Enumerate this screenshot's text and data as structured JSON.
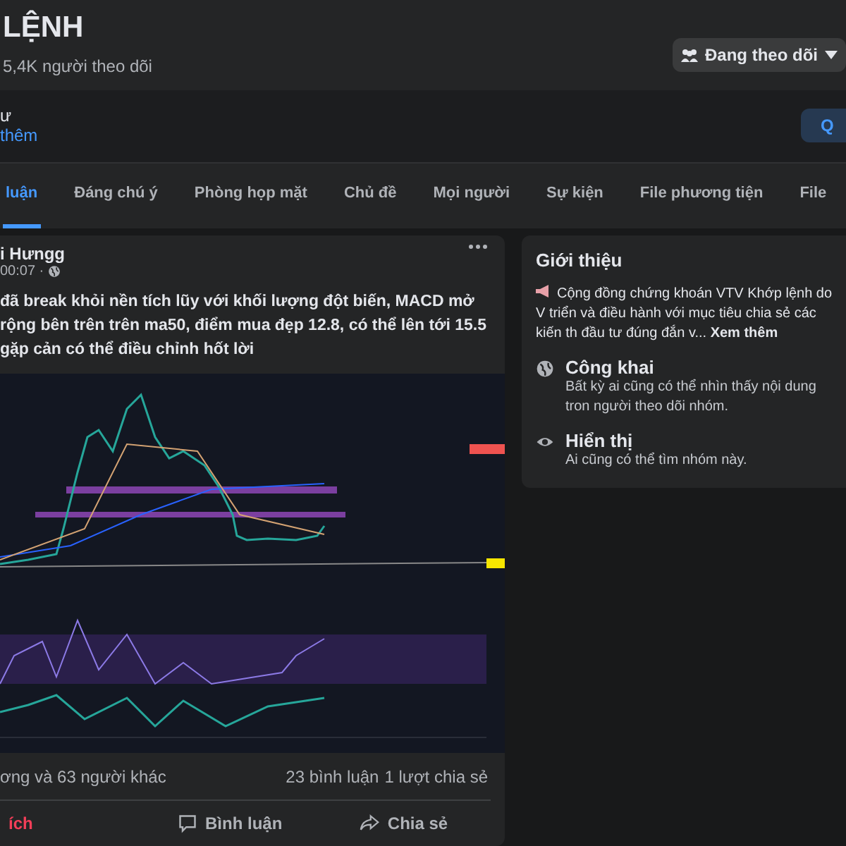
{
  "group": {
    "title": "LỆNH",
    "followers": "5,4K người theo dõi",
    "follow_button": "Đang theo dõi"
  },
  "banner": {
    "text_1": "ư",
    "link": "thêm",
    "button": "Q"
  },
  "tabs": [
    {
      "label": "luận",
      "selected": true
    },
    {
      "label": "Đáng chú ý",
      "selected": false
    },
    {
      "label": "Phòng họp mặt",
      "selected": false
    },
    {
      "label": "Chủ đề",
      "selected": false
    },
    {
      "label": "Mọi người",
      "selected": false
    },
    {
      "label": "Sự kiện",
      "selected": false
    },
    {
      "label": "File phương tiện",
      "selected": false
    },
    {
      "label": "File",
      "selected": false
    }
  ],
  "post": {
    "author": "i Hưngg",
    "time": "00:07 ·",
    "text": "đã break khỏi nền tích lũy với khối lượng đột biến, MACD mở rộng bên trên trên ma50, điểm mua đẹp 12.8, có thể lên tới 15.5 gặp cản có thể điều chỉnh hốt lời",
    "reactions": "ơng và 63 người khác",
    "comments": "23 bình luận",
    "shares": "1 lượt chia sẻ",
    "actions": [
      {
        "kind": "like",
        "label": "ích",
        "active": true
      },
      {
        "kind": "comment",
        "label": "Bình luận",
        "active": false
      },
      {
        "kind": "share",
        "label": "Chia sẻ",
        "active": false
      }
    ]
  },
  "about": {
    "title": "Giới thiệu",
    "description": "Cộng đồng chứng khoán VTV Khớp lệnh do V triển và điều hành với mục tiêu chia sẻ các kiến th đầu tư đúng đắn v...",
    "more": "Xem thêm",
    "items": [
      {
        "kind": "public",
        "title": "Công khai",
        "text": "Bất kỳ ai cũng có thể nhìn thấy nội dung tron người theo dõi nhóm."
      },
      {
        "kind": "visible",
        "title": "Hiển thị",
        "text": "Ai cũng có thể tìm nhóm này."
      }
    ]
  }
}
